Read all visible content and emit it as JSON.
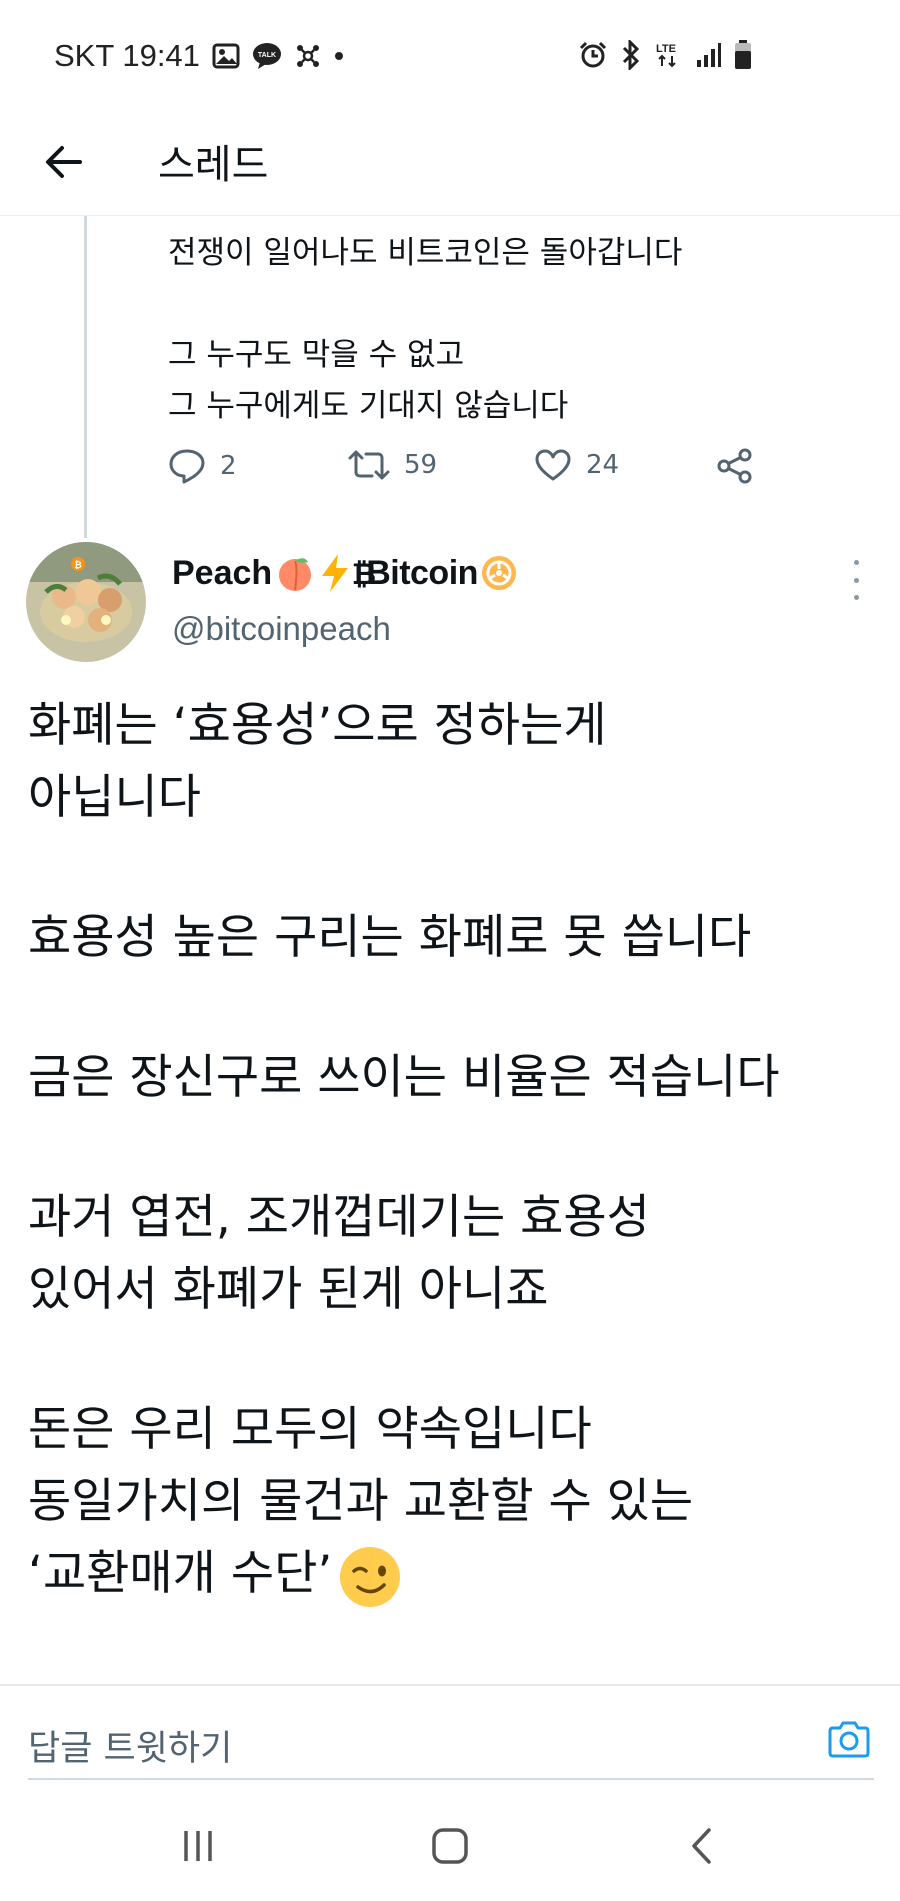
{
  "status_bar": {
    "carrier_time": "SKT 19:41",
    "network": "LTE",
    "battery_level": 0.7
  },
  "header": {
    "title": "스레드"
  },
  "previous_tweet": {
    "paragraphs": [
      "전쟁이 일어나도 비트코인은 돌아갑니다",
      "그 누구도 막을 수 없고\n그 누구에게도 기대지 않습니다"
    ],
    "replies": "2",
    "retweets": "59",
    "likes": "24"
  },
  "tweet": {
    "author_name": "Peach",
    "author_name_suffix": "Bitcoin",
    "author_handle": "@bitcoinpeach",
    "paragraphs": [
      "화폐는 ‘효용성’으로 정하는게\n아닙니다",
      "효용성 높은 구리는 화폐로 못 씁니다",
      "금은 장신구로 쓰이는 비율은 적습니다",
      "과거 엽전, 조개껍데기는 효용성\n있어서 화폐가 된게 아니죠"
    ],
    "last_paragraph": "돈은 우리 모두의 약속입니다\n동일가치의 물건과 교환할 수 있는\n‘교환매개 수단’"
  },
  "reply_bar": {
    "placeholder": "답글 트윗하기"
  },
  "colors": {
    "text": "#0f1419",
    "secondary": "#536471",
    "accent": "#1d9bf0",
    "divider": "#e7e9ea"
  },
  "icons": {
    "back": "arrow-left-icon",
    "reply": "speech-bubble-icon",
    "retweet": "retweet-icon",
    "like": "heart-icon",
    "share": "share-icon",
    "camera": "camera-icon"
  }
}
